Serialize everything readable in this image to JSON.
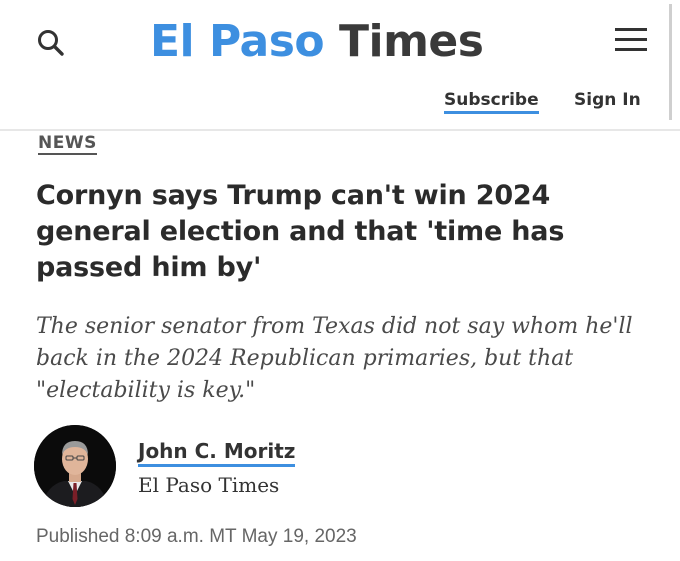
{
  "header": {
    "logo_part1": "El Paso",
    "logo_part2": "Times",
    "subscribe_label": "Subscribe",
    "signin_label": "Sign In",
    "search_icon": "search-icon",
    "menu_icon": "hamburger-menu-icon"
  },
  "article": {
    "section": "NEWS",
    "headline": "Cornyn says Trump can't win 2024 general election and that 'time has passed him by'",
    "subhead": "The senior senator from Texas did not say whom he'll back in the 2024 Republican primaries, but that \"electability is key.\"",
    "author": "John C. Moritz",
    "publication": "El Paso Times",
    "published": "Published 8:09 a.m. MT May 19, 2023"
  },
  "colors": {
    "brand_blue": "#3d8fe0",
    "logo_dark": "#3a3a3a",
    "text": "#2b2b2b",
    "muted": "#666666"
  }
}
